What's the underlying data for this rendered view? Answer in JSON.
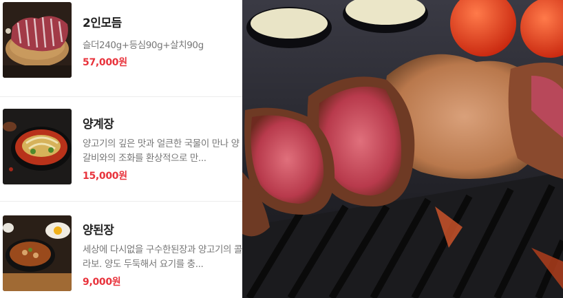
{
  "menu": [
    {
      "name": "2인모듬",
      "description": "슬더240g+등심90g+살치90g",
      "price": "57,000원",
      "thumb_icon": "lamb-platter-photo"
    },
    {
      "name": "양계장",
      "description": "양고기의 깊은 맛과 얼큰한 국물이 만나 양갈비와의 조화를 환상적으로 만...",
      "price": "15,000원",
      "thumb_icon": "spicy-soup-photo"
    },
    {
      "name": "양된장",
      "description": "세상에 다시없을 구수한된장과 양고기의 콜라보. 양도 두둑해서 요기를 충...",
      "price": "9,000원",
      "thumb_icon": "doenjang-stew-photo"
    }
  ],
  "hero": {
    "icon": "grilled-lamb-photo"
  },
  "colors": {
    "price": "#e8333c",
    "name": "#222222",
    "desc": "#777777",
    "divider": "#ececec"
  }
}
